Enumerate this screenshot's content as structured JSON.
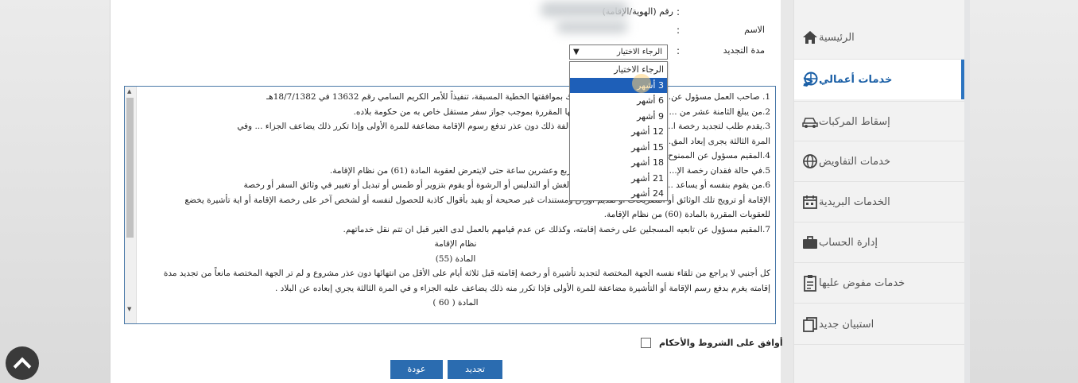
{
  "fields": {
    "id_label": "رقم (الهوية/الإقامة)",
    "name_label": "الاسم",
    "renewal_label": "مدة التجديد",
    "colon": ":"
  },
  "renewal_select": {
    "selected": "الرجاء الاختيار",
    "options": [
      "الرجاء الاختيار",
      "3 أشهر",
      "6 أشهر",
      "9 أشهر",
      "12 أشهر",
      "15 أشهر",
      "18 أشهر",
      "21 أشهر",
      "24 أشهر"
    ],
    "highlighted_option": "3 أشهر"
  },
  "terms": [
    "1. صاحب العمل مسؤول عن... المقيم لديه للغير اذا تم ذلك بموافقتها الخطية المسبقة، تنفيذاً للأمر الكريم السامي رقم 13632 في 18/7/1382هـ",
    "2.من يبلغ الثامنة عشر من ... ل على رخصة إقامة بشروطها المقررة بموجب جواز سفر مستقل خاص به من حكومة بلاده.",
    "3.يقدم طلب لتجديد رخصة ا... ها على الأقل وفي حالة مخالفة ذلك دون عذر تدفع رسوم الإقامة مضاعفة للمرة الأولى وإذا تكرر ذلك يضاعف الجزاء ... وفي",
    "المرة الثالثة يجرى إبعاد المق... (55) من نظام الإقامة.",
    "4.المقيم مسؤول عن الممنوح...",
    "5.في حالة فقدان رخصة الإ... وازات خلال مدة لاتزيد عن أربع وعشرين ساعة حتى لايتعرض لعقوبة المادة (61) من نظام الإقامة.",
    "6.من يقوم بنفسه أو يساعد ... الإقامة أو التأشيرة بطريق الغش أو التدليس أو الرشوة أو يقوم بتزوير أو طمس أو تبديل أو تغيير في وثائق السفر أو رخصة",
    "الإقامة أو ترويج تلك الوثائق أو التصريحات أو تقديم أوراق ومستندات غير صحيحة أو يفيد بأقوال كاذبة للحصول لنفسه أو لشخص آخر على رخصة الإقامة أو اية تأشيرة يخضع",
    "للعقوبات المقررة بالمادة (60) من نظام الإقامة.",
    "7.المقيم مسؤول عن تابعيه المسجلين على رخصة إقامته، وكذلك عن عدم قيامهم بالعمل لدى الغير قبل ان تتم نقل خدماتهم.",
    "نظام الإقامة",
    "المادة (55)",
    "كل أجنبي لا يراجع من تلقاء نفسه الجهة المختصة لتجديد تأشيرة أو رخصة إقامته قبل ثلاثة أيام على الأقل من انتهائها دون عذر مشروع و لم تر الجهة المختصة مانعاً من تجديد مدة",
    "إقامته يغرم بدفع رسم الإقامة أو التأشيرة مضاعفة للمرة الأولى فإذا تكرر منه ذلك يضاعف عليه الجزاء و في المرة الثالثة يجري إبعاده عن البلاد .",
    "المادة ( 60 )"
  ],
  "agree_label": "أوافق على الشروط والأحكام",
  "buttons": {
    "renew": "تجديد",
    "back": "عودة"
  },
  "sidebar": {
    "items": [
      {
        "label": "الرئيسية",
        "icon": "home-icon"
      },
      {
        "label": "خدمات أعمالي",
        "icon": "globe-hand-icon",
        "active": true
      },
      {
        "label": "إسقاط المركبات",
        "icon": "car-icon"
      },
      {
        "label": "خدمات التفاويض",
        "icon": "globe-icon"
      },
      {
        "label": "الخدمات البريدية",
        "icon": "calendar-icon"
      },
      {
        "label": "إدارة الحساب",
        "icon": "briefcase-icon"
      },
      {
        "label": "خدمات مفوض عليها",
        "icon": "clipboard-icon"
      },
      {
        "label": "استبيان جديد",
        "icon": "copy-icon"
      }
    ]
  },
  "colors": {
    "accent": "#2b6cb0",
    "active_text": "#1a5fa6",
    "selection": "#1e5fb8"
  }
}
